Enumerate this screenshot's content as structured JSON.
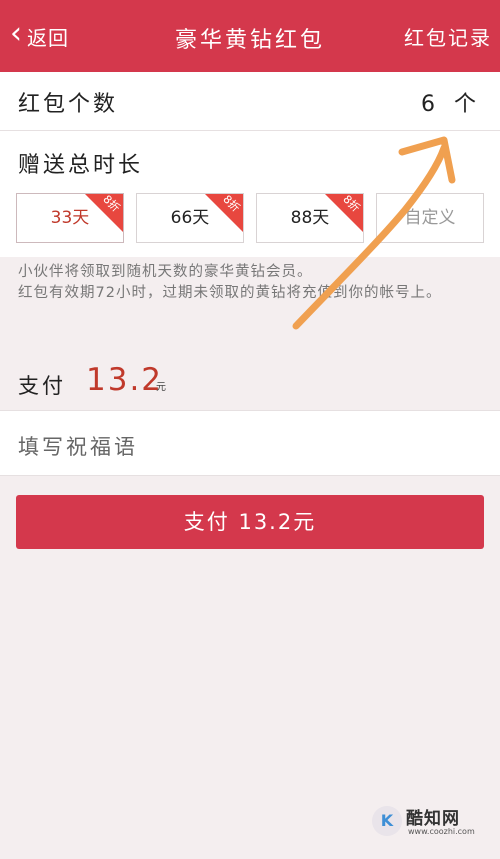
{
  "nav": {
    "back_label": "返回",
    "title": "豪华黄钻红包",
    "record_label": "红包记录",
    "color": "#d4384c"
  },
  "count": {
    "label": "红包个数",
    "value": "6 个"
  },
  "duration": {
    "label": "赠送总时长",
    "options": [
      {
        "label": "33天",
        "badge": "8折",
        "selected": true
      },
      {
        "label": "66天",
        "badge": "8折",
        "selected": false
      },
      {
        "label": "88天",
        "badge": "8折",
        "selected": false
      },
      {
        "label": "自定义",
        "badge": "",
        "selected": false
      }
    ]
  },
  "note": {
    "line1": "小伙伴将领取到随机天数的豪华黄钻会员。",
    "line2": "红包有效期72小时，过期未领取的黄钻将充值到你的帐号上。"
  },
  "payment": {
    "label": "支付",
    "amount": "13.2",
    "unit": "元",
    "accent": "#c0392b"
  },
  "wish": {
    "placeholder": "填写祝福语"
  },
  "pay_button": {
    "label": "支付 13.2元"
  },
  "watermark": {
    "name": "酷知网",
    "url": "www.coozhi.com"
  },
  "annotation": {
    "arrow_color": "#f0a050"
  }
}
